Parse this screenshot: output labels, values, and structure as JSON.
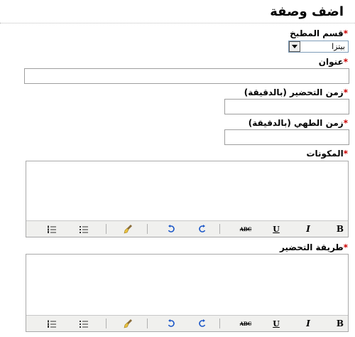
{
  "page": {
    "title": "اضف وصفة"
  },
  "form": {
    "category": {
      "label": "قسم المطبخ",
      "required_mark": "*",
      "selected": "بيتزا"
    },
    "title_field": {
      "label": "عنوان",
      "required_mark": "*",
      "value": ""
    },
    "prep_time": {
      "label": "زمن التحضير (بالدقيقة)",
      "required_mark": "*",
      "value": ""
    },
    "cook_time": {
      "label": "زمن الطهي (بالدقيقة)",
      "required_mark": "*",
      "value": ""
    },
    "ingredients": {
      "label": "المكونات",
      "required_mark": "*"
    },
    "method": {
      "label": "طريقة التحضير",
      "required_mark": "*"
    }
  },
  "toolbar": {
    "bold": "B",
    "italic": "I",
    "underline": "U",
    "strike": "ABC",
    "icons": [
      "bold-icon",
      "italic-icon",
      "underline-icon",
      "strikethrough-icon",
      "undo-icon",
      "redo-icon",
      "cleanup-icon",
      "bullet-list-icon",
      "numbered-list-icon"
    ]
  },
  "colors": {
    "required": "#cc0000",
    "toolbar_bg": "#f0f0ee",
    "border": "#a9a9a9"
  }
}
